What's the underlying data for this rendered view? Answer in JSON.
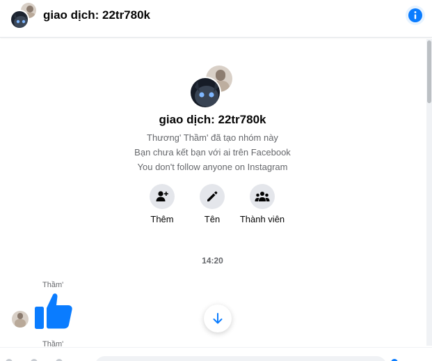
{
  "header": {
    "title": "giao dịch: 22tr780k",
    "info_icon": "info-icon",
    "accent": "#0a7cff"
  },
  "intro": {
    "group_name": "giao dịch: 22tr780k",
    "created_by": "Thương' Thầm' đã tạo nhóm này",
    "facebook_note": "Bạn chưa kết bạn với ai trên Facebook",
    "instagram_note": "You don't follow anyone on Instagram"
  },
  "actions": [
    {
      "label": "Thêm",
      "icon": "add-person-icon"
    },
    {
      "label": "Tên",
      "icon": "pencil-icon"
    },
    {
      "label": "Thành viên",
      "icon": "members-icon"
    }
  ],
  "thread": {
    "timestamp": "14:20",
    "messages": [
      {
        "sender": "Thầm'",
        "content": "like-icon"
      },
      {
        "sender": "Thầm'"
      }
    ]
  },
  "colors": {
    "like": "#0a7cff",
    "secondary_text": "#65676b",
    "button_bg": "#e4e6eb"
  }
}
